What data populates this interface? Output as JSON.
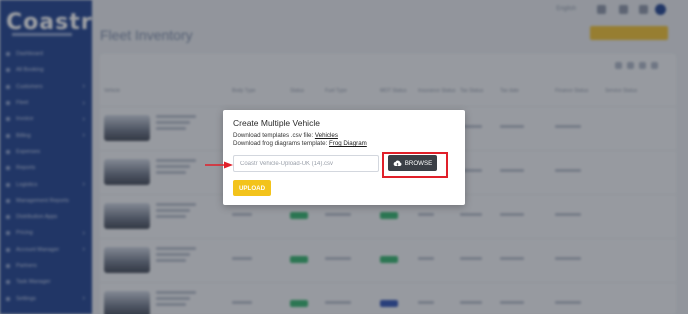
{
  "app": {
    "logo": "Coastr",
    "page_title": "Fleet Inventory",
    "language": "English",
    "nav": [
      {
        "label": "Dashboard",
        "arrow": false
      },
      {
        "label": "All Booking",
        "arrow": false
      },
      {
        "label": "Customers",
        "arrow": true
      },
      {
        "label": "Fleet",
        "arrow": true
      },
      {
        "label": "Invoice",
        "arrow": true
      },
      {
        "label": "Billing",
        "arrow": true
      },
      {
        "label": "Expenses",
        "arrow": false
      },
      {
        "label": "Reports",
        "arrow": false
      },
      {
        "label": "Logistics",
        "arrow": true
      },
      {
        "label": "Management Reports",
        "arrow": false
      },
      {
        "label": "Distribution Apps",
        "arrow": false
      },
      {
        "label": "Pricing",
        "arrow": true
      },
      {
        "label": "Account Manager",
        "arrow": true
      },
      {
        "label": "Partners",
        "arrow": false
      },
      {
        "label": "Task Manager",
        "arrow": false
      },
      {
        "label": "Settings",
        "arrow": true
      }
    ],
    "table_headers": [
      "Vehicle",
      "Body Type",
      "Status",
      "Fuel Type",
      "MOT Status",
      "Insurance Status",
      "Tax Status",
      "Tax date",
      "Finance Status",
      "Service Status"
    ]
  },
  "modal": {
    "title": "Create Multiple Vehicle",
    "templates_prefix": "Download templates .csv file:",
    "templates_link": "Vehicles",
    "frog_prefix": "Download frog diagrams template:",
    "frog_link": "Frog Diagram",
    "file_value": "Coastr Vehicle-Upload-UK (14).csv",
    "browse_label": "BROWSE",
    "upload_label": "UPLOAD"
  },
  "colors": {
    "sidebar": "#1c3f8f",
    "accent_yellow": "#f3c31b",
    "browse_dark": "#3b3f46",
    "annotation_red": "#e0202a"
  }
}
